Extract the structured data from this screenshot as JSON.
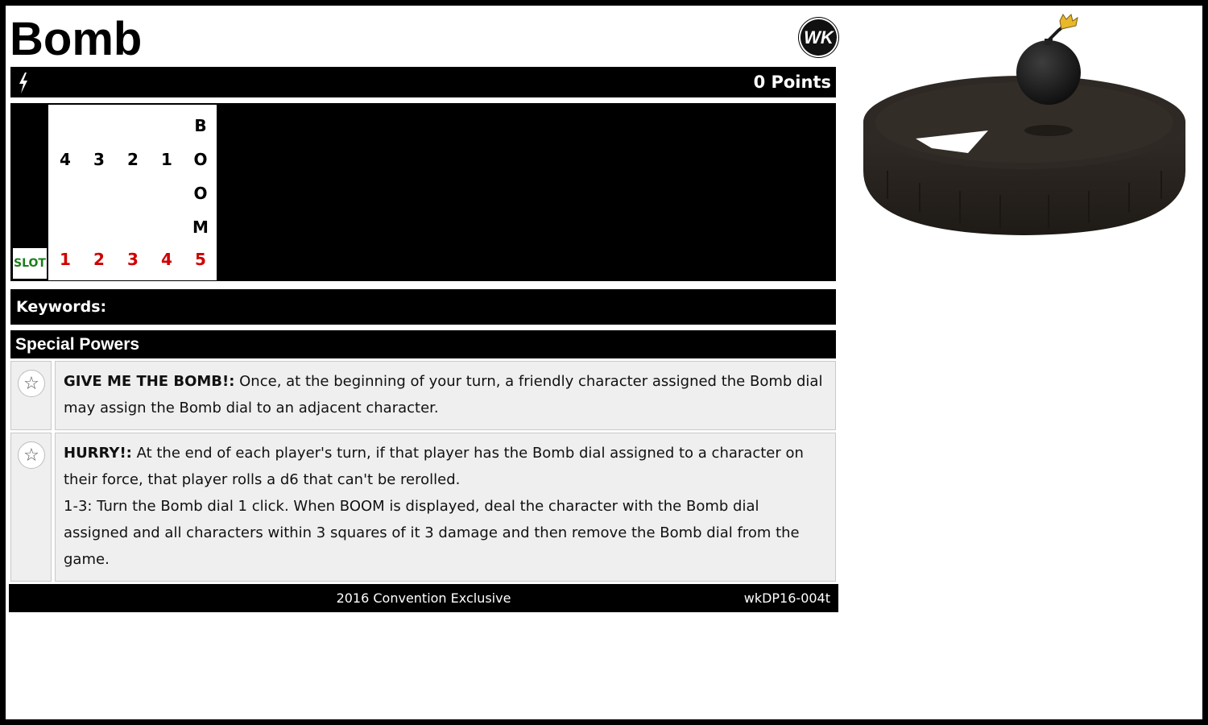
{
  "title": "Bomb",
  "logo_text": "WK",
  "speed_icon": "lightning-bolt-icon",
  "points": "0 Points",
  "dial": {
    "slot_label": "SLOT",
    "rows": [
      [
        "",
        "",
        "",
        "",
        "B"
      ],
      [
        "4",
        "3",
        "2",
        "1",
        "O"
      ],
      [
        "",
        "",
        "",
        "",
        "O"
      ],
      [
        "",
        "",
        "",
        "",
        "M"
      ]
    ],
    "clicks": [
      "1",
      "2",
      "3",
      "4",
      "5"
    ]
  },
  "keywords_label": "Keywords:",
  "special_powers_label": "Special Powers",
  "powers": [
    {
      "icon": "star-icon",
      "name": "GIVE ME THE BOMB!:",
      "text": "Once, at the beginning of your turn, a friendly character assigned the Bomb dial may assign the Bomb dial to an adjacent character."
    },
    {
      "icon": "star-icon",
      "name": "HURRY!:",
      "text": "At the end of each player's turn, if that player has the Bomb dial assigned to a character on their force, that player rolls a d6 that can't be rerolled.",
      "text2": "1-3: Turn the Bomb dial 1 click. When BOOM is displayed, deal the character with the Bomb dial assigned and all characters within 3 squares of it 3 damage and then remove the Bomb dial from the game."
    }
  ],
  "footer": {
    "set_name": "2016 Convention Exclusive",
    "code": "wkDP16-004t"
  },
  "colors": {
    "slot_green": "#1a7f1a",
    "click_red": "#d00000",
    "panel_gray": "#efefef"
  }
}
